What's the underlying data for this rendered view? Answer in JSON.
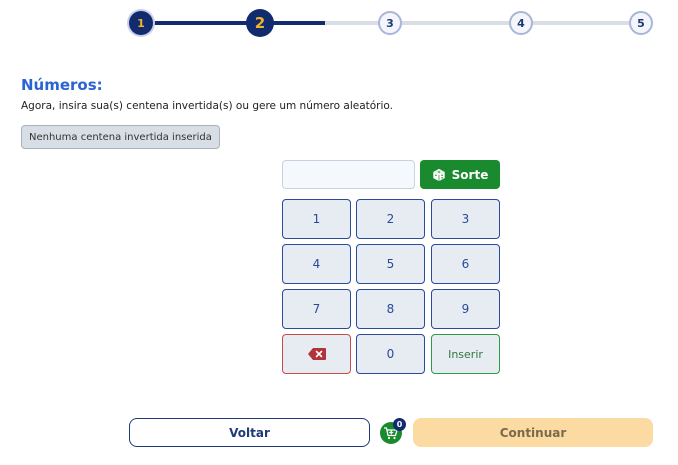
{
  "stepper": {
    "steps": [
      {
        "label": "1",
        "state": "done"
      },
      {
        "label": "2",
        "state": "current"
      },
      {
        "label": "3",
        "state": "todo"
      },
      {
        "label": "4",
        "state": "todo"
      },
      {
        "label": "5",
        "state": "todo"
      }
    ]
  },
  "section": {
    "title": "Números:",
    "subtitle": "Agora, insira sua(s) centena invertida(s) ou gere um número aleatório.",
    "chip": "Nenhuma centena invertida inserida"
  },
  "input": {
    "value": "",
    "placeholder": ""
  },
  "sorte_label": "Sorte",
  "keypad": {
    "keys": [
      "1",
      "2",
      "3",
      "4",
      "5",
      "6",
      "7",
      "8",
      "9"
    ],
    "zero": "0",
    "insert": "Inserir",
    "delete_icon": "backspace-icon"
  },
  "footer": {
    "back": "Voltar",
    "cart_count": "0",
    "continue": "Continuar"
  },
  "colors": {
    "primary": "#122a6e",
    "accent": "#f0b429",
    "success": "#1a8a2e",
    "danger": "#c84a4a",
    "title": "#2a63d4",
    "continue_bg": "#fcdba3"
  }
}
